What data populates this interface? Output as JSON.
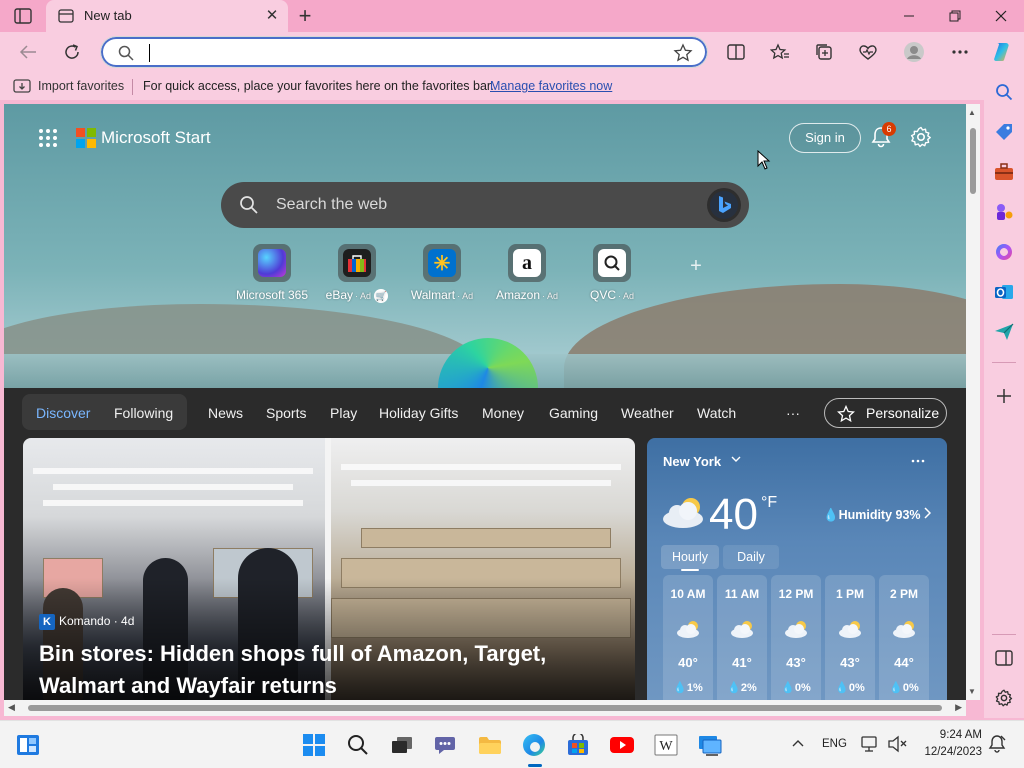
{
  "browser": {
    "tab": {
      "title": "New tab"
    },
    "address": {
      "value": "",
      "placeholder": ""
    },
    "favorites_bar": {
      "import_label": "Import favorites",
      "message": "For quick access, place your favorites here on the favorites bar.",
      "manage_link": "Manage favorites now"
    }
  },
  "start": {
    "brand": "Microsoft Start",
    "signin_label": "Sign in",
    "notification_count": "6",
    "search_placeholder": "Search the web",
    "quicklinks": [
      {
        "label": "Microsoft 365",
        "ad": "",
        "color": "#3b3bd6"
      },
      {
        "label": "eBay",
        "ad": "· Ad",
        "color": "#e53238"
      },
      {
        "label": "Walmart",
        "ad": "· Ad",
        "color": "#0071ce"
      },
      {
        "label": "Amazon",
        "ad": "· Ad",
        "color": "#ffffff"
      },
      {
        "label": "QVC",
        "ad": "· Ad",
        "color": "#ffffff"
      }
    ]
  },
  "feed": {
    "nav": [
      "Discover",
      "Following",
      "News",
      "Sports",
      "Play",
      "Holiday Gifts",
      "Money",
      "Gaming",
      "Weather",
      "Watch",
      "···"
    ],
    "personalize_label": "Personalize",
    "hero": {
      "source_logo": "K",
      "source": "Komando · 4d",
      "title": "Bin stores: Hidden shops full of Amazon, Target, Walmart and Wayfair returns"
    }
  },
  "weather": {
    "city": "New York",
    "temp": "40",
    "unit": "°F",
    "humidity": "Humidity 93%",
    "tabs": [
      "Hourly",
      "Daily"
    ],
    "hours": [
      {
        "time": "10 AM",
        "temp": "40°",
        "precip": "1%"
      },
      {
        "time": "11 AM",
        "temp": "41°",
        "precip": "2%"
      },
      {
        "time": "12 PM",
        "temp": "43°",
        "precip": "0%"
      },
      {
        "time": "1 PM",
        "temp": "43°",
        "precip": "0%"
      },
      {
        "time": "2 PM",
        "temp": "44°",
        "precip": "0%"
      }
    ]
  },
  "taskbar": {
    "language": "ENG",
    "time": "9:24 AM",
    "date": "12/24/2023"
  },
  "colors": {
    "browser_frame": "#f9cde0",
    "accent": "#0067c0",
    "active_nav": "#7ab7ff"
  }
}
